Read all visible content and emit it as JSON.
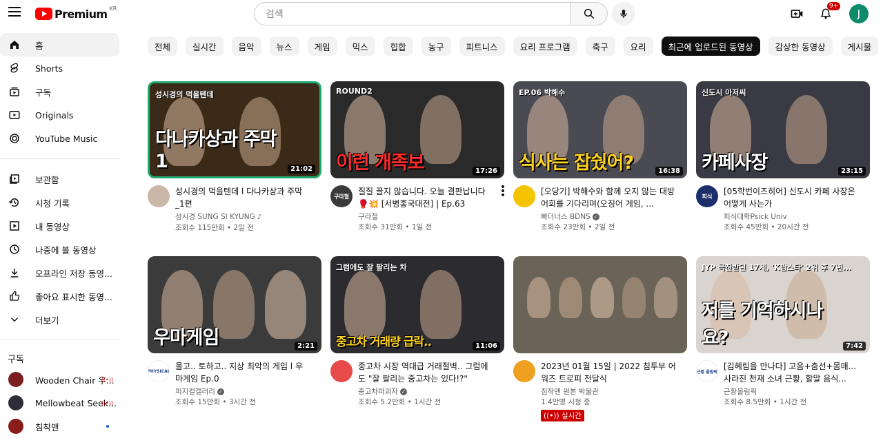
{
  "header": {
    "logo_word": "Premium",
    "country_code": "KR",
    "search_placeholder": "검색",
    "notification_count": "9+",
    "avatar_letter": "J"
  },
  "sidebar": {
    "main": [
      {
        "label": "홈",
        "icon": "home-icon"
      },
      {
        "label": "Shorts",
        "icon": "shorts-icon"
      },
      {
        "label": "구독",
        "icon": "subscriptions-icon"
      },
      {
        "label": "Originals",
        "icon": "originals-icon"
      },
      {
        "label": "YouTube Music",
        "icon": "music-icon"
      }
    ],
    "library": [
      {
        "label": "보관함",
        "icon": "library-icon"
      },
      {
        "label": "시청 기록",
        "icon": "history-icon"
      },
      {
        "label": "내 동영상",
        "icon": "your-videos-icon"
      },
      {
        "label": "나중에 볼 동영상",
        "icon": "watch-later-icon"
      },
      {
        "label": "오프라인 저장 동영...",
        "icon": "download-icon"
      },
      {
        "label": "좋아요 표시한 동영...",
        "icon": "like-icon"
      },
      {
        "label": "더보기",
        "icon": "chevron-down-icon"
      }
    ],
    "subscriptions_heading": "구독",
    "subscriptions": [
      {
        "label": "Wooden Chair 우...",
        "status": "live",
        "color": "#7a1f1f"
      },
      {
        "label": "Mellowbeat Seek...",
        "status": "live",
        "color": "#2d2d3a"
      },
      {
        "label": "침착맨",
        "status": "new",
        "color": "#8a1c1c"
      }
    ]
  },
  "chips": [
    "전체",
    "실시간",
    "음악",
    "뉴스",
    "게임",
    "믹스",
    "힙합",
    "농구",
    "피트니스",
    "요리 프로그램",
    "축구",
    "요리",
    "최근에 업로드된 동영상",
    "감상한 동영상",
    "게시물"
  ],
  "active_chip": "최근에 업로드된 동영상",
  "videos": [
    {
      "title": "성시경의 먹을텐데 l 다나카상과 주막 _1편",
      "channel": "성시경 SUNG SI KYUNG",
      "channel_mark": "♪",
      "stats": "조회수 115만회 • 2일 전",
      "duration": "21:02",
      "thumb_text": "다나카상과 주막 1",
      "thumb_sub": "성시경의 먹을텐데",
      "avatar_text": "",
      "thumb_bg": "#3b2a18",
      "accent": "#1faa6e",
      "avatar_color": "#c9b7a8"
    },
    {
      "title": "질질 끌지 않습니다. 오늘 결판납니다🥊💥 [서병홍국대전] | Ep.63",
      "channel": "구라철",
      "channel_mark": "",
      "stats": "조회수 31만회 • 1일 전",
      "duration": "17:26",
      "thumb_text": "이런 개족보",
      "thumb_sub": "ROUND2",
      "avatar_text": "구라철",
      "thumb_bg": "#2a2a2a",
      "accent": "#ff2a2a",
      "avatar_color": "#3a3a3a"
    },
    {
      "title": "[오당기] 박해수와 함께 오지 않는 대방어회를 기다리며(오징어 게임, ...",
      "channel": "빠더너스 BDNS",
      "channel_mark": "✓",
      "stats": "조회수 23만회 • 2일 전",
      "duration": "16:38",
      "thumb_text": "식사는 잡쉈어?",
      "thumb_sub": "EP.06 박해수",
      "avatar_text": "",
      "thumb_bg": "#4a4a52",
      "accent": "#ffd21f",
      "avatar_color": "#f5c400"
    },
    {
      "title": "[05학번이즈히어] 신도시 카페 사장은 어떻게 사는가",
      "channel": "피식대학Psick Univ",
      "channel_mark": "",
      "stats": "조회수 45만회 • 20시간 전",
      "duration": "23:15",
      "thumb_text": "카페사장",
      "thumb_sub": "신도시 아저씨",
      "avatar_text": "피식",
      "thumb_bg": "#3a3a44",
      "accent": "#ffffff",
      "avatar_color": "#1c2f6b"
    },
    {
      "title": "울고.. 토하고.. 지상 최악의 게임 l 우마게임 Ep.0",
      "channel": "피지컬갤러리",
      "channel_mark": "✓",
      "stats": "조회수 15만회 • 3시간 전",
      "duration": "2:21",
      "thumb_text": "우마게임",
      "thumb_sub": "",
      "avatar_text": "PHYSICAL",
      "thumb_bg": "#3b3b3b",
      "accent": "#ffffff",
      "avatar_color": "#ffffff"
    },
    {
      "title": "중고차 시장 역대급 거래절벽.. 그럼에도 \"잘 팔리는 중고차는 있다!?\"",
      "channel": "중고차파괴자",
      "channel_mark": "✓",
      "stats": "조회수 5.2만회 • 1시간 전",
      "duration": "11:06",
      "thumb_text": "중고차 거래량 급락..",
      "thumb_sub": "그럼에도 잘 팔리는 차",
      "avatar_text": "",
      "thumb_bg": "#2b2b30",
      "accent": "#ffd21f",
      "avatar_color": "#e84a4a"
    },
    {
      "title": "2023년 01월 15일 | 2022 침투부 어워즈 트로피 전달식",
      "channel": "침착맨 원본 박물관",
      "channel_mark": "",
      "stats": "1.4만명 시청 중",
      "duration": "",
      "live_label": "실시간",
      "thumb_text": "",
      "thumb_sub": "",
      "avatar_text": "",
      "thumb_bg": "#6a6458",
      "accent": "#ffffff",
      "avatar_color": "#f0a020"
    },
    {
      "title": "[김혜림을 만나다] 고음+춤선+몸매... 사라진 천재 소녀 근황, 할말 음식...",
      "channel": "근황올림픽",
      "channel_mark": "",
      "stats": "조회수 8.5만회 • 1시간 전",
      "duration": "7:42",
      "thumb_text": "저를 기억하시나요?",
      "thumb_sub": "JYP 극찬받던 17세, 'K팝스타' 2위 후 7년...",
      "avatar_text": "근황 올림픽",
      "thumb_bg": "#d9d4cf",
      "accent": "#ffffff",
      "avatar_color": "#ffffff"
    }
  ]
}
